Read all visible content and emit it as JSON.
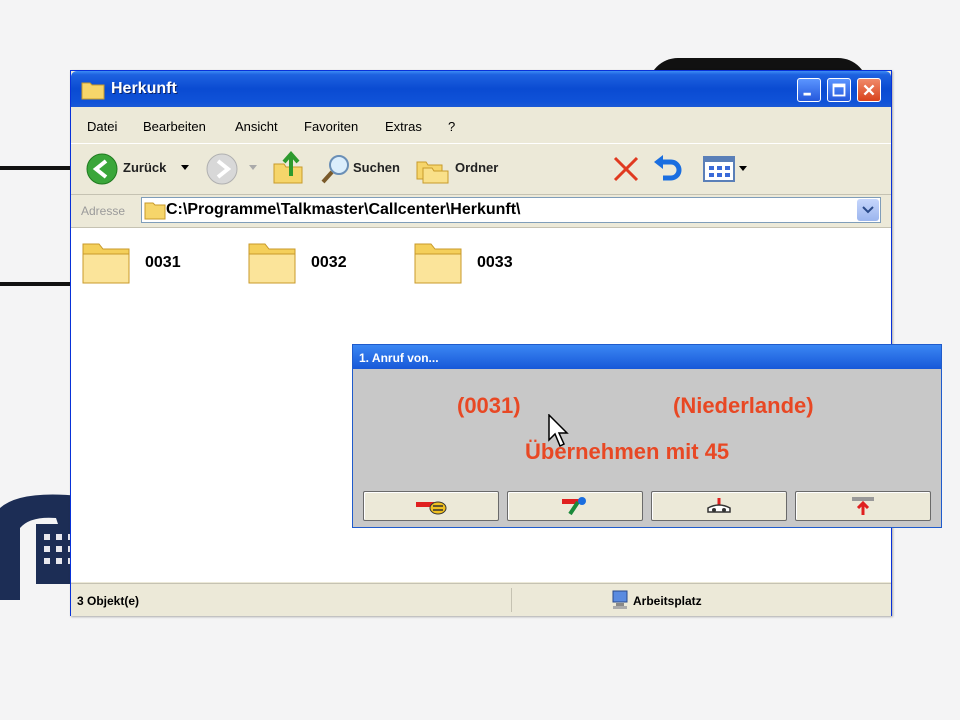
{
  "window": {
    "title": "Herkunft"
  },
  "menu": [
    "Datei",
    "Bearbeiten",
    "Ansicht",
    "Favoriten",
    "Extras",
    "?"
  ],
  "toolbar": {
    "back_label": "Zurück",
    "search_label": "Suchen",
    "folders_label": "Ordner"
  },
  "address": {
    "label": "Adresse",
    "path": "C:\\Programme\\Talkmaster\\Callcenter\\Herkunft\\"
  },
  "folders": [
    {
      "name": "0031"
    },
    {
      "name": "0032"
    },
    {
      "name": "0033"
    }
  ],
  "status": {
    "objects": "3 Objekt(e)",
    "location": "Arbeitsplatz"
  },
  "popup": {
    "title": "1. Anruf von...",
    "code": "(0031)",
    "country": "(Niederlande)",
    "message": "Übernehmen mit 45"
  },
  "colors": {
    "xp_blue": "#0a4bd2",
    "popup_text": "#e84824"
  }
}
